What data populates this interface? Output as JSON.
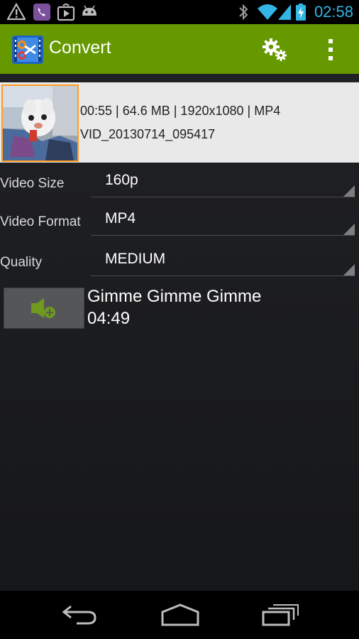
{
  "status_bar": {
    "time": "02:58",
    "icons": [
      "warning-icon",
      "viber-icon",
      "play-store-icon",
      "android-icon",
      "bluetooth-icon",
      "wifi-icon",
      "signal-icon",
      "battery-charging-icon"
    ],
    "accent_color": "#33b5e5"
  },
  "action_bar": {
    "title": "Convert",
    "background_color": "#669900",
    "icons": [
      "app-icon",
      "settings-icon",
      "overflow-menu-icon"
    ]
  },
  "video": {
    "meta": "00:55 | 64.6 MB | 1920x1080 | MP4",
    "filename": "VID_20130714_095417",
    "thumbnail_border_color": "#ff9a1f"
  },
  "settings": {
    "video_size": {
      "label": "Video Size",
      "value": "160p"
    },
    "video_format": {
      "label": "Video Format",
      "value": "MP4"
    },
    "quality": {
      "label": "Quality",
      "value": "MEDIUM"
    }
  },
  "audio": {
    "title": "Gimme Gimme Gimme",
    "duration": "04:49",
    "icon": "add-audio-icon"
  },
  "nav_bar": {
    "icons": [
      "back-icon",
      "home-icon",
      "recent-apps-icon"
    ]
  }
}
